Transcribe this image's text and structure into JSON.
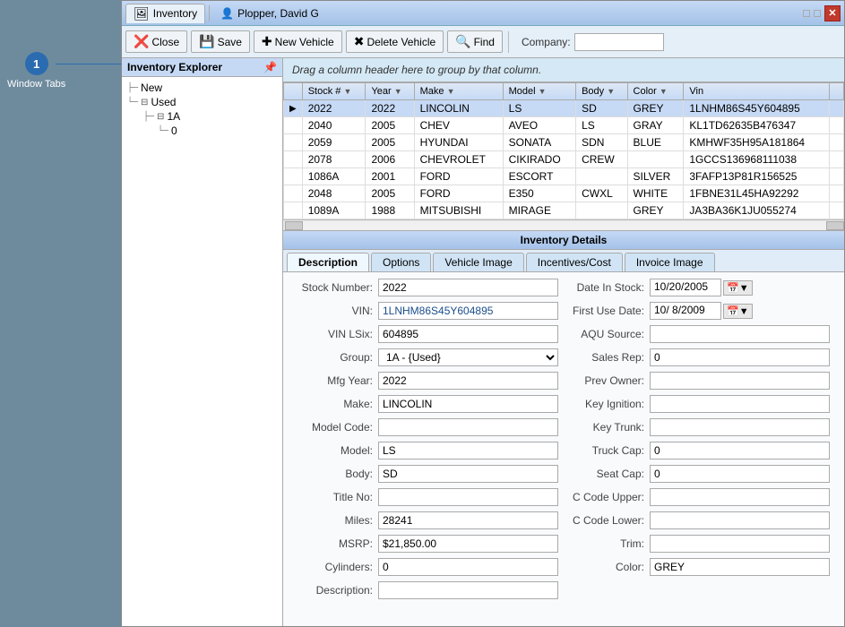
{
  "annotation": {
    "number": "1",
    "label": "Window Tabs"
  },
  "titleBar": {
    "tab1_icon": "🖼",
    "tab1_label": "Inventory",
    "tab2_icon": "👤",
    "tab2_label": "Plopper, David G",
    "close_label": "✕"
  },
  "toolbar": {
    "close_label": "Close",
    "save_label": "Save",
    "new_vehicle_label": "New Vehicle",
    "delete_vehicle_label": "Delete Vehicle",
    "find_label": "Find",
    "company_label": "Company:"
  },
  "sidebar": {
    "header": "Inventory Explorer",
    "pin_icon": "📌",
    "items": [
      {
        "label": "New",
        "level": 1
      },
      {
        "label": "Used",
        "level": 1,
        "expanded": true
      },
      {
        "label": "1A",
        "level": 2,
        "selected": true
      },
      {
        "label": "0",
        "level": 3
      }
    ]
  },
  "dragHint": "Drag a column header here to group by that column.",
  "grid": {
    "columns": [
      {
        "label": "Stock #",
        "key": "stock"
      },
      {
        "label": "Year",
        "key": "year"
      },
      {
        "label": "Make",
        "key": "make"
      },
      {
        "label": "Model",
        "key": "model"
      },
      {
        "label": "Body",
        "key": "body"
      },
      {
        "label": "Color",
        "key": "color"
      },
      {
        "label": "Vin",
        "key": "vin"
      }
    ],
    "rows": [
      {
        "selected": true,
        "indicator": "▶",
        "stock": "2022",
        "year": "2022",
        "make": "LINCOLIN",
        "model": "LS",
        "body": "SD",
        "color": "GREY",
        "vin": "1LNHM86S45Y604895"
      },
      {
        "selected": false,
        "indicator": "",
        "stock": "2040",
        "year": "2005",
        "make": "CHEV",
        "model": "AVEO",
        "body": "LS",
        "color": "GRAY",
        "vin": "KL1TD62635B476347"
      },
      {
        "selected": false,
        "indicator": "",
        "stock": "2059",
        "year": "2005",
        "make": "HYUNDAI",
        "model": "SONATA",
        "body": "SDN",
        "color": "BLUE",
        "vin": "KMHWF35H95A181864"
      },
      {
        "selected": false,
        "indicator": "",
        "stock": "2078",
        "year": "2006",
        "make": "CHEVROLET",
        "model": "CIKIRADO",
        "body": "CREW",
        "color": "",
        "vin": "1GCCS136968111038"
      },
      {
        "selected": false,
        "indicator": "",
        "stock": "1086A",
        "year": "2001",
        "make": "FORD",
        "model": "ESCORT",
        "body": "",
        "color": "SILVER",
        "vin": "3FAFP13P81R156525"
      },
      {
        "selected": false,
        "indicator": "",
        "stock": "2048",
        "year": "2005",
        "make": "FORD",
        "model": "E350",
        "body": "CWXL",
        "color": "WHITE",
        "vin": "1FBNE31L45HA92292"
      },
      {
        "selected": false,
        "indicator": "",
        "stock": "1089A",
        "year": "1988",
        "make": "MITSUBISHI",
        "model": "MIRAGE",
        "body": "",
        "color": "GREY",
        "vin": "JA3BA36K1JU055274"
      }
    ]
  },
  "details": {
    "title": "Inventory Details",
    "tabs": [
      "Description",
      "Options",
      "Vehicle Image",
      "Incentives/Cost",
      "Invoice Image"
    ],
    "activeTab": "Description",
    "left": {
      "fields": [
        {
          "label": "Stock Number:",
          "value": "2022",
          "type": "text"
        },
        {
          "label": "VIN:",
          "value": "1LNHM86S45Y604895",
          "type": "text",
          "blue": true
        },
        {
          "label": "VIN LSix:",
          "value": "604895",
          "type": "text"
        },
        {
          "label": "Group:",
          "value": "1A - {Used}",
          "type": "select"
        },
        {
          "label": "Mfg Year:",
          "value": "2022",
          "type": "text"
        },
        {
          "label": "Make:",
          "value": "LINCOLIN",
          "type": "text"
        },
        {
          "label": "Model Code:",
          "value": "",
          "type": "text"
        },
        {
          "label": "Model:",
          "value": "LS",
          "type": "text"
        },
        {
          "label": "Body:",
          "value": "SD",
          "type": "text"
        },
        {
          "label": "Title No:",
          "value": "",
          "type": "text"
        },
        {
          "label": "Miles:",
          "value": "28241",
          "type": "text"
        },
        {
          "label": "MSRP:",
          "value": "$21,850.00",
          "type": "text"
        },
        {
          "label": "Cylinders:",
          "value": "0",
          "type": "text"
        },
        {
          "label": "Description:",
          "value": "",
          "type": "text"
        }
      ]
    },
    "right": {
      "fields": [
        {
          "label": "Date In Stock:",
          "value": "10/20/2005",
          "type": "date"
        },
        {
          "label": "First Use Date:",
          "value": "10/ 8/2009",
          "type": "date"
        },
        {
          "label": "AQU Source:",
          "value": "",
          "type": "text"
        },
        {
          "label": "Sales Rep:",
          "value": "0",
          "type": "text"
        },
        {
          "label": "Prev Owner:",
          "value": "",
          "type": "text"
        },
        {
          "label": "Key Ignition:",
          "value": "",
          "type": "text"
        },
        {
          "label": "Key Trunk:",
          "value": "",
          "type": "text"
        },
        {
          "label": "Truck Cap:",
          "value": "0",
          "type": "text"
        },
        {
          "label": "Seat Cap:",
          "value": "0",
          "type": "text"
        },
        {
          "label": "C Code Upper:",
          "value": "",
          "type": "text"
        },
        {
          "label": "C Code Lower:",
          "value": "",
          "type": "text"
        },
        {
          "label": "Trim:",
          "value": "",
          "type": "text"
        },
        {
          "label": "Color:",
          "value": "GREY",
          "type": "text"
        }
      ]
    }
  }
}
